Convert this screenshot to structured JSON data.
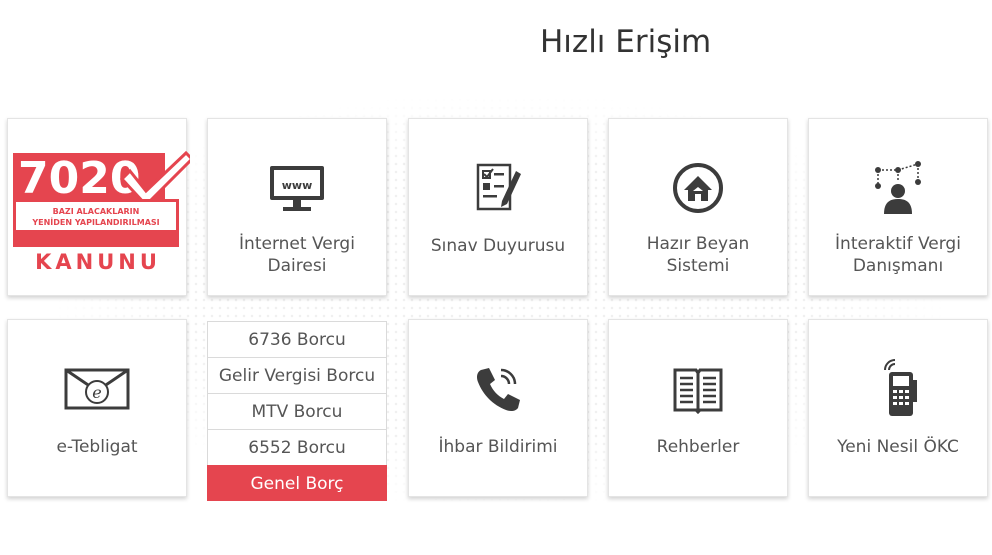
{
  "page": {
    "title": "Hızlı Erişim"
  },
  "logo": {
    "number": "7020",
    "subtitle_line1": "BAZI ALACAKLARIN",
    "subtitle_line2": "YENİDEN YAPILANDIRILMASI",
    "word": "KANUNU",
    "color": "#e5454f"
  },
  "tiles": {
    "internet_vergi": {
      "label_line1": "İnternet Vergi",
      "label_line2": "Dairesi",
      "icon_text": "www"
    },
    "sinav": {
      "label": "Sınav Duyurusu"
    },
    "hazir_beyan": {
      "label_line1": "Hazır Beyan",
      "label_line2": "Sistemi"
    },
    "interaktif": {
      "label_line1": "İnteraktif Vergi",
      "label_line2": "Danışmanı"
    },
    "etebligat": {
      "label": "e-Tebligat"
    },
    "ihbar": {
      "label": "İhbar Bildirimi"
    },
    "rehberler": {
      "label": "Rehberler"
    },
    "okc": {
      "label": "Yeni Nesil ÖKC"
    }
  },
  "debt_links": [
    {
      "label": "6736 Borcu"
    },
    {
      "label": "Gelir Vergisi Borcu"
    },
    {
      "label": "MTV Borcu"
    },
    {
      "label": "6552 Borcu"
    },
    {
      "label": "Genel Borç"
    }
  ],
  "colors": {
    "accent": "#e5454f",
    "icon": "#3c3c3c"
  },
  "icons": [
    "kanun-7020-logo",
    "monitor-www-icon",
    "checklist-pen-icon",
    "house-globe-icon",
    "network-person-icon",
    "email-envelope-icon",
    "phone-ringing-icon",
    "open-book-icon",
    "pos-device-icon"
  ]
}
